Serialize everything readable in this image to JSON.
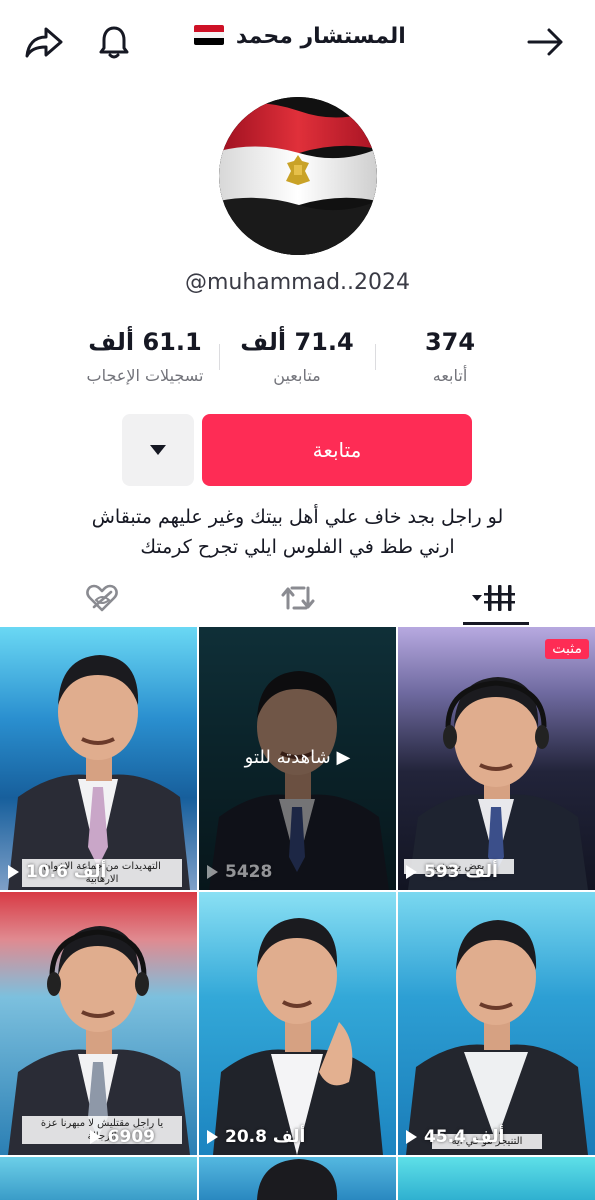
{
  "header": {
    "title": "المستشار محمد",
    "flag_colors": [
      "#ce1126",
      "#ffffff",
      "#000000"
    ]
  },
  "profile": {
    "handle": "@muhammad..2024"
  },
  "stats": [
    {
      "value": "374",
      "label": "أتابعه"
    },
    {
      "value": "71.4 ألف",
      "label": "متابعين"
    },
    {
      "value": "61.1 ألف",
      "label": "تسجيلات الإعجاب"
    }
  ],
  "actions": {
    "follow_label": "متابعة"
  },
  "bio": {
    "line1": "لو راجل بجد خاف علي أهل بيتك وغير عليهم متبقاش",
    "line2": "ارني طظ في الفلوس ايلي تجرح كرمتك"
  },
  "tabs": [
    "videos-grid",
    "reposts",
    "liked-hidden"
  ],
  "videos": [
    {
      "views": "593 ألف",
      "pinned": "مثبت",
      "caption": "بعض يهسني",
      "bg": [
        "#2b2d4a",
        "#8b7fb8"
      ]
    },
    {
      "views": "5428",
      "watched": "شاهدته للتو",
      "caption": "",
      "bg": [
        "#0f3b4a",
        "#1a6a80"
      ]
    },
    {
      "views": "10.6 ألف",
      "caption": "التهديدات من جماعة الاخوان الارهابية",
      "bg": [
        "#1877b8",
        "#58c4e8"
      ]
    },
    {
      "views": "45.4 ألف",
      "caption": "التنيجر هو في ايه",
      "bg": [
        "#1a8ec4",
        "#6ad0f0"
      ]
    },
    {
      "views": "20.8 ألف",
      "caption": "",
      "bg": [
        "#1a9fd0",
        "#7fd8f4"
      ]
    },
    {
      "views": "6909",
      "caption": "يا راجل مقتليش لا مبهرنا عزة الرجالة",
      "bg": [
        "#c8303a",
        "#6bb7d8"
      ]
    }
  ]
}
